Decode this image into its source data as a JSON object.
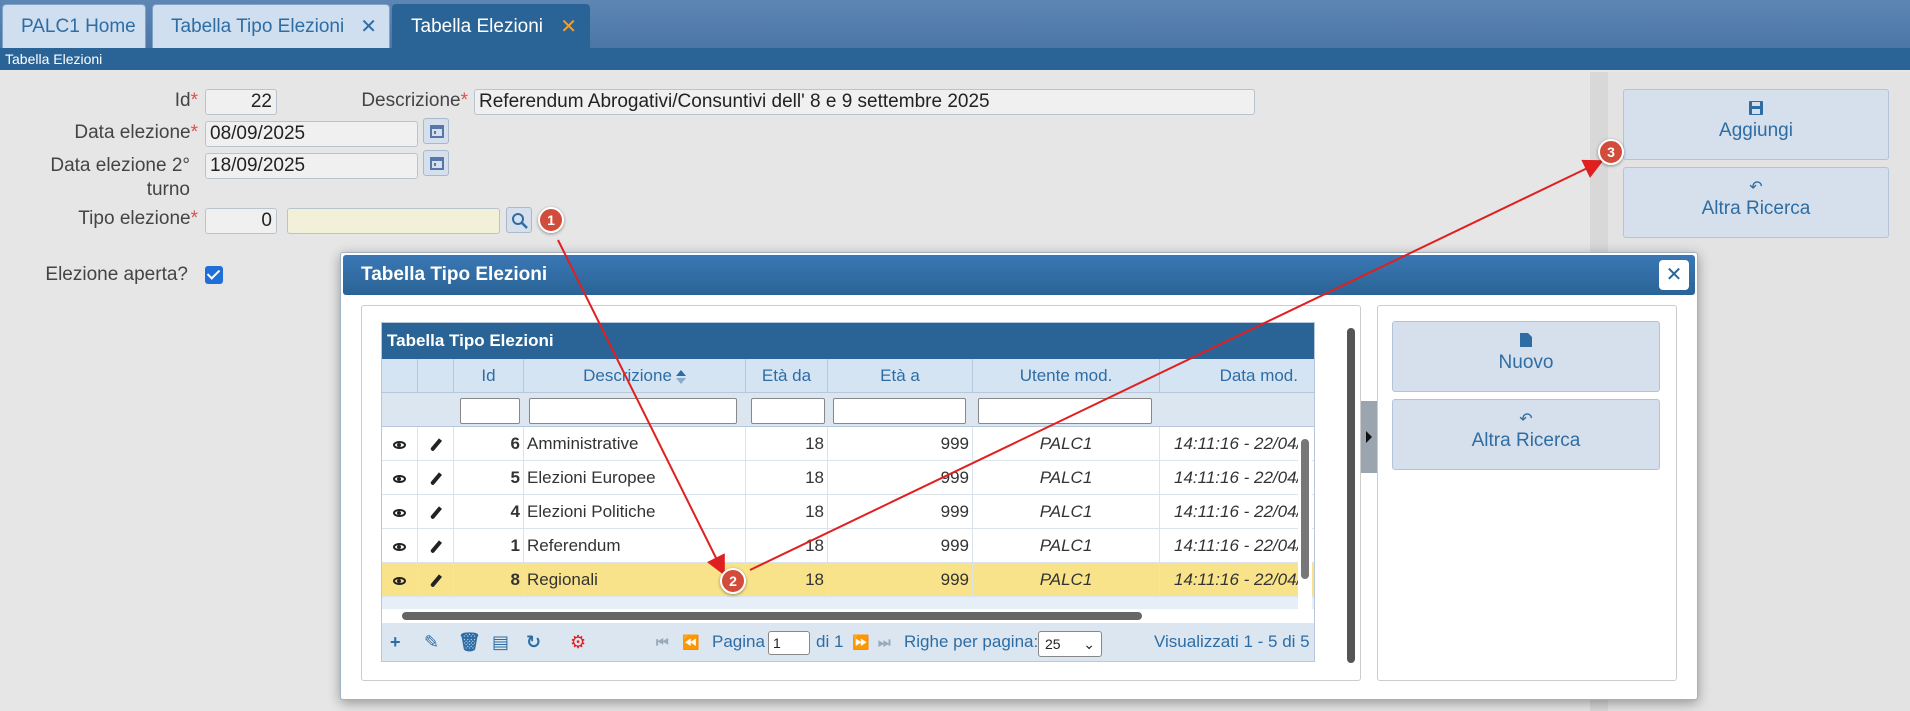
{
  "tabs": [
    {
      "label": "PALC1 Home"
    },
    {
      "label": "Tabella Tipo Elezioni",
      "close": "✕"
    },
    {
      "label": "Tabella Elezioni",
      "close": "✕"
    }
  ],
  "breadcrumb": "Tabella Elezioni",
  "form": {
    "id_label": "Id",
    "id_value": "22",
    "descrizione_label": "Descrizione",
    "descrizione_value": "Referendum Abrogativi/Consuntivi dell' 8 e 9 settembre 2025",
    "data_label": "Data elezione",
    "data_value": "08/09/2025",
    "data2_label_line1": "Data elezione 2°",
    "data2_label_line2": "turno",
    "data2_value": "18/09/2025",
    "tipo_label": "Tipo elezione",
    "tipo_value": "0",
    "tipo_desc": "",
    "aperta_label": "Elezione aperta?",
    "required_mark": "*"
  },
  "actions": {
    "aggiungi": "Aggiungi",
    "altra_ricerca": "Altra Ricerca"
  },
  "badges": [
    "1",
    "2",
    "3"
  ],
  "dialog": {
    "title": "Tabella Tipo Elezioni",
    "close": "✕",
    "grid_title": "Tabella Tipo Elezioni",
    "columns": [
      "Id",
      "Descrizione",
      "Età da",
      "Età a",
      "Utente mod.",
      "Data mod."
    ],
    "rows": [
      {
        "id": "6",
        "descrizione": "Amministrative",
        "eta_da": "18",
        "eta_a": "999",
        "utente": "PALC1",
        "data": "14:11:16 - 22/04/"
      },
      {
        "id": "5",
        "descrizione": "Elezioni Europee",
        "eta_da": "18",
        "eta_a": "999",
        "utente": "PALC1",
        "data": "14:11:16 - 22/04/"
      },
      {
        "id": "4",
        "descrizione": "Elezioni Politiche",
        "eta_da": "18",
        "eta_a": "999",
        "utente": "PALC1",
        "data": "14:11:16 - 22/04/"
      },
      {
        "id": "1",
        "descrizione": "Referendum",
        "eta_da": "18",
        "eta_a": "999",
        "utente": "PALC1",
        "data": "14:11:16 - 22/04/"
      },
      {
        "id": "8",
        "descrizione": "Regionali",
        "eta_da": "18",
        "eta_a": "999",
        "utente": "PALC1",
        "data": "14:11:16 - 22/04/"
      }
    ],
    "pager": {
      "pagina_label": "Pagina",
      "page": "1",
      "di_label": "di 1",
      "righe_label": "Righe per pagina:",
      "righe_value": "25",
      "summary": "Visualizzati 1 - 5 di 5"
    },
    "side": {
      "nuovo": "Nuovo",
      "altra_ricerca": "Altra Ricerca"
    }
  },
  "colors": {
    "header_blue": "#2a6496",
    "selected_row": "#f8e38a",
    "badge": "#d24c3b",
    "arrow": "#e02020",
    "required": "#d9534f"
  }
}
